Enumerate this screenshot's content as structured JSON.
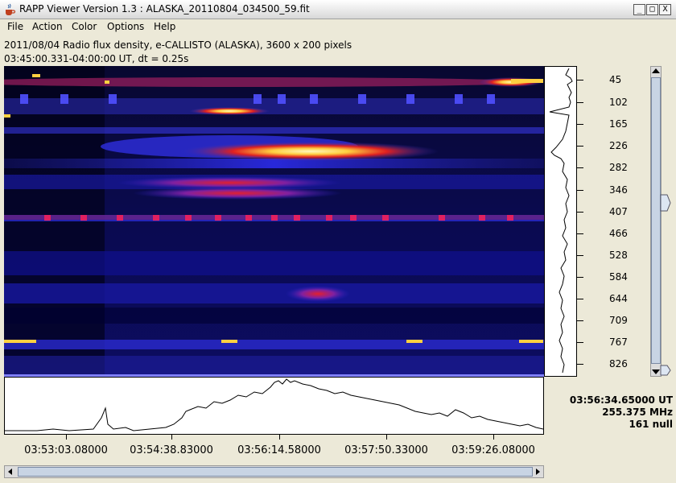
{
  "window": {
    "title": "RAPP Viewer Version 1.3 : ALASKA_20110804_034500_59.fit",
    "minimize": "_",
    "maximize": "□",
    "close": "X"
  },
  "menu": {
    "items": [
      "File",
      "Action",
      "Color",
      "Options",
      "Help"
    ]
  },
  "info": {
    "line1": "2011/08/04  Radio flux density, e-CALLISTO (ALASKA),  3600 x 200 pixels",
    "line2": "03:45:00.331-04:00:00 UT,  dt = 0.25s"
  },
  "freq_axis": {
    "labels": [
      "45",
      "102",
      "165",
      "226",
      "282",
      "346",
      "407",
      "466",
      "528",
      "584",
      "644",
      "709",
      "767",
      "826"
    ]
  },
  "time_axis": {
    "labels": [
      "03:53:03.08000",
      "03:54:38.83000",
      "03:56:14.58000",
      "03:57:50.33000",
      "03:59:26.08000"
    ]
  },
  "readout": {
    "time": "03:56:34.65000 UT",
    "freq": "255.375 MHz",
    "value": "161 null"
  },
  "colors": {
    "spectrogram_background": "#000000",
    "band_blue": "#1a1aff",
    "band_red": "#e02020",
    "band_yellow": "#ffe060",
    "window_face": "#ece9d8"
  }
}
